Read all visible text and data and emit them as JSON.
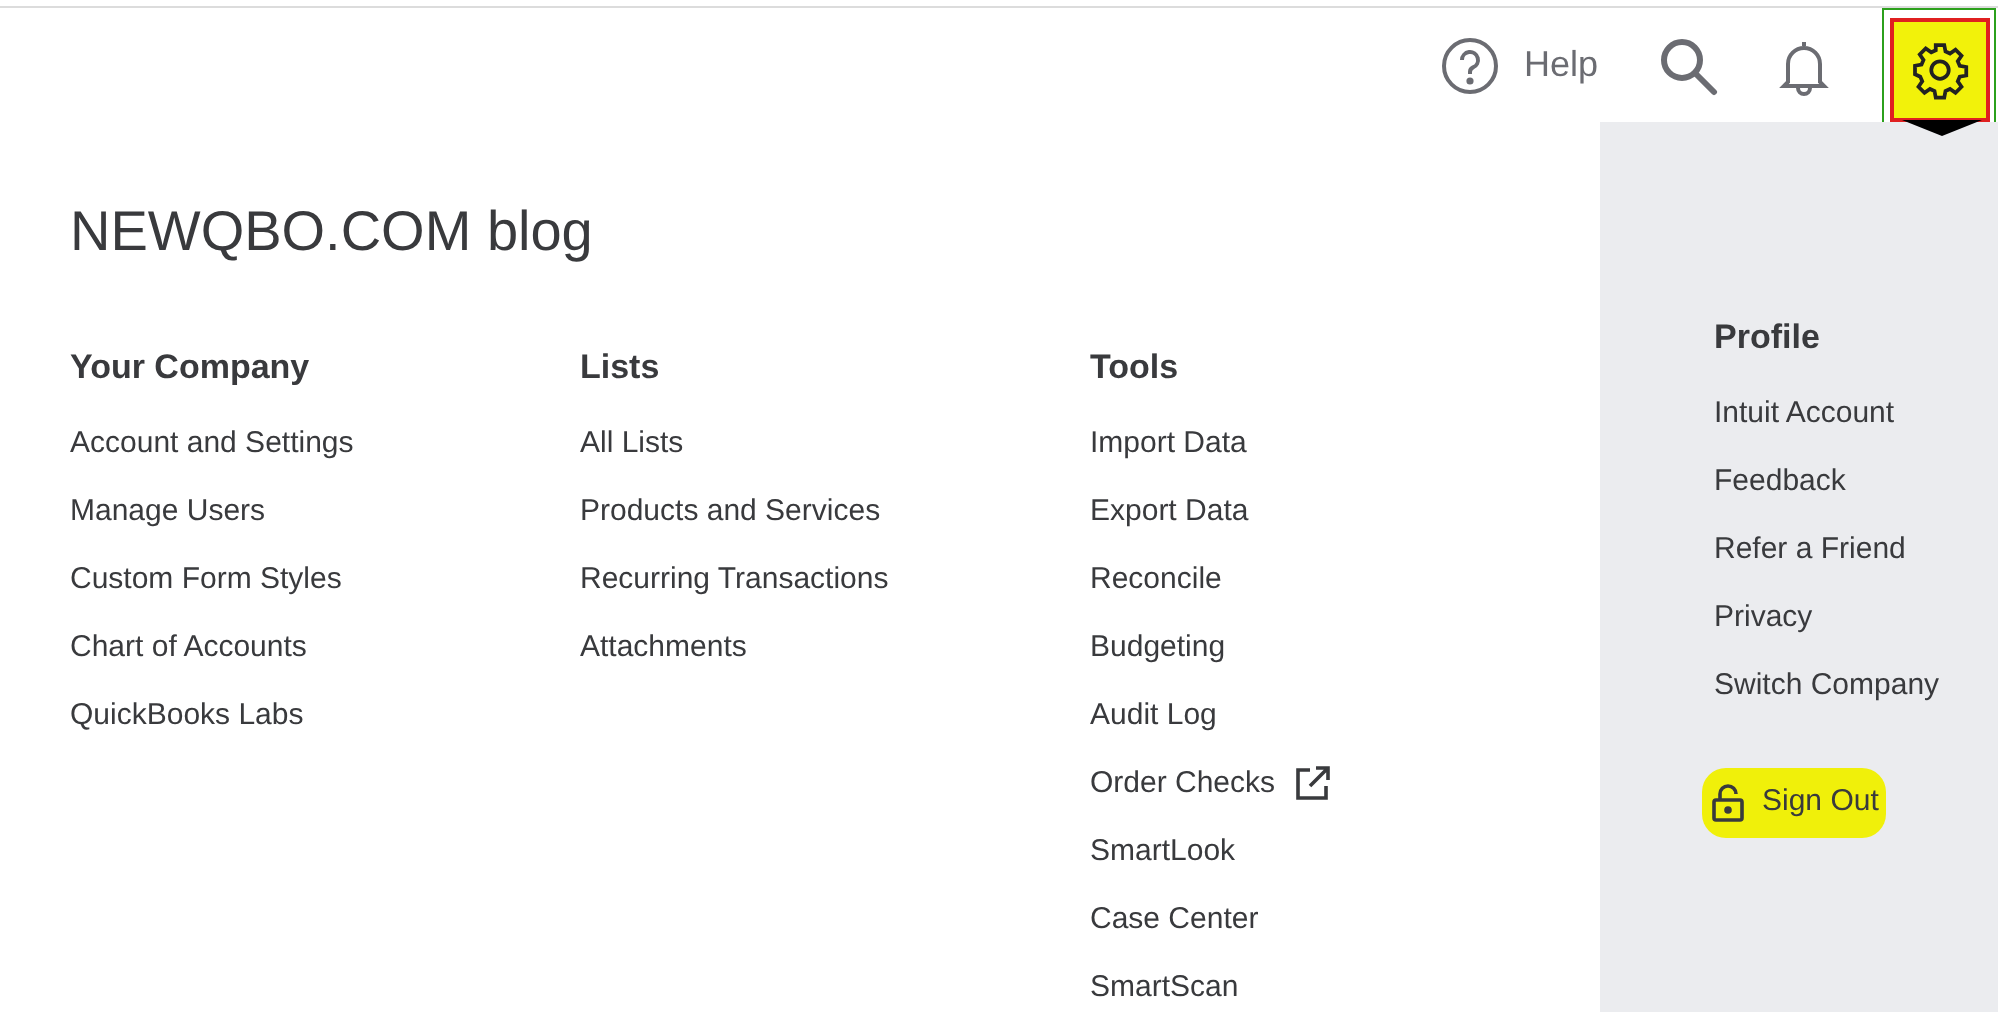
{
  "top_bar": {
    "help_label": "Help"
  },
  "menu": {
    "title": "NEWQBO.COM blog",
    "columns": [
      {
        "heading": "Your Company",
        "items": [
          {
            "label": "Account and Settings"
          },
          {
            "label": "Manage Users"
          },
          {
            "label": "Custom Form Styles"
          },
          {
            "label": "Chart of Accounts"
          },
          {
            "label": "QuickBooks Labs"
          }
        ]
      },
      {
        "heading": "Lists",
        "items": [
          {
            "label": "All Lists"
          },
          {
            "label": "Products and Services"
          },
          {
            "label": "Recurring Transactions"
          },
          {
            "label": "Attachments"
          }
        ]
      },
      {
        "heading": "Tools",
        "items": [
          {
            "label": "Import Data"
          },
          {
            "label": "Export Data"
          },
          {
            "label": "Reconcile"
          },
          {
            "label": "Budgeting"
          },
          {
            "label": "Audit Log"
          },
          {
            "label": "Order Checks",
            "kind": "external"
          },
          {
            "label": "SmartLook"
          },
          {
            "label": "Case Center"
          },
          {
            "label": "SmartScan"
          }
        ]
      }
    ],
    "profile": {
      "heading": "Profile",
      "items": [
        {
          "label": "Intuit Account"
        },
        {
          "label": "Feedback"
        },
        {
          "label": "Refer a Friend"
        },
        {
          "label": "Privacy"
        },
        {
          "label": "Switch Company"
        }
      ],
      "sign_out": "Sign Out"
    }
  }
}
